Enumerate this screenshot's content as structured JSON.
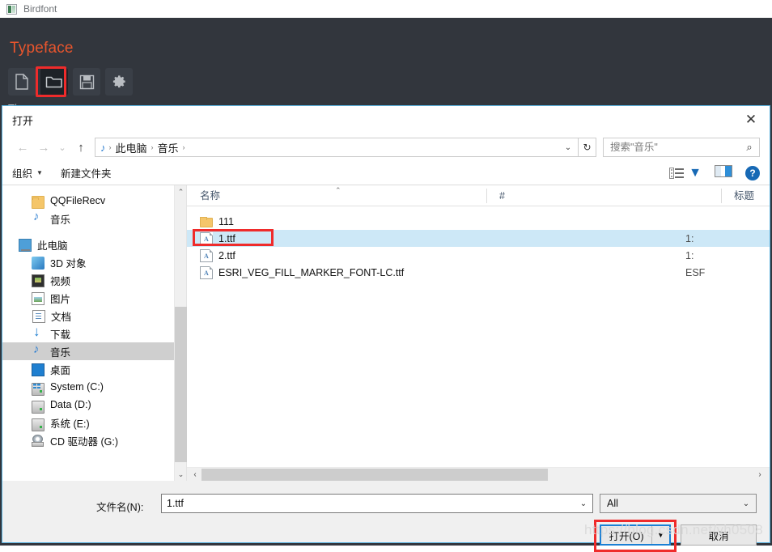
{
  "app": {
    "titlebar_title": "Birdfont",
    "section_title": "Typeface",
    "themes_label": "Themes",
    "accent_color": "#e8552d",
    "toolbar": [
      {
        "name": "new-file-icon",
        "label": "New"
      },
      {
        "name": "open-folder-icon",
        "label": "Open"
      },
      {
        "name": "save-icon",
        "label": "Save"
      },
      {
        "name": "settings-gear-icon",
        "label": "Settings"
      }
    ]
  },
  "dialog": {
    "title": "打开",
    "close_label": "✕",
    "nav": {
      "back": "←",
      "forward": "→",
      "recent": "⌄",
      "up": "↑"
    },
    "breadcrumb": {
      "leading_icon": "music-note-icon",
      "parts": [
        "此电脑",
        "音乐"
      ],
      "separator": "›",
      "caret": "⌄"
    },
    "refresh": "↻",
    "search": {
      "placeholder": "搜索\"音乐\"",
      "value": "",
      "icon": "search-icon"
    },
    "commands": {
      "organize": "组织",
      "organize_caret": "▼",
      "new_folder": "新建文件夹",
      "view_caret": "▼",
      "help": "?"
    },
    "tree": [
      {
        "label": "QQFileRecv",
        "icon": "folder-icon",
        "indent": 36,
        "selected": false
      },
      {
        "label": "音乐",
        "icon": "music-note-icon",
        "indent": 36,
        "selected": false
      },
      {
        "gap": true
      },
      {
        "label": "此电脑",
        "icon": "this-pc-icon",
        "indent": 20,
        "selected": false
      },
      {
        "label": "3D 对象",
        "icon": "3d-objects-icon",
        "indent": 36,
        "selected": false
      },
      {
        "label": "视频",
        "icon": "videos-icon",
        "indent": 36,
        "selected": false
      },
      {
        "label": "图片",
        "icon": "pictures-icon",
        "indent": 36,
        "selected": false
      },
      {
        "label": "文档",
        "icon": "documents-icon",
        "indent": 36,
        "selected": false
      },
      {
        "label": "下载",
        "icon": "downloads-icon",
        "indent": 36,
        "selected": false
      },
      {
        "label": "音乐",
        "icon": "music-note-icon",
        "indent": 36,
        "selected": true
      },
      {
        "label": "桌面",
        "icon": "desktop-icon",
        "indent": 36,
        "selected": false
      },
      {
        "label": "System (C:)",
        "icon": "system-drive-icon",
        "indent": 36,
        "selected": false
      },
      {
        "label": "Data (D:)",
        "icon": "drive-icon",
        "indent": 36,
        "selected": false
      },
      {
        "label": "系统 (E:)",
        "icon": "drive-icon",
        "indent": 36,
        "selected": false
      },
      {
        "label": "CD 驱动器 (G:)",
        "icon": "cd-drive-icon",
        "indent": 36,
        "selected": false
      }
    ],
    "columns": [
      {
        "label": "名称",
        "key": "name"
      },
      {
        "label": "#",
        "key": "hash"
      },
      {
        "label": "标题",
        "key": "title"
      }
    ],
    "sort_caret": "⌃",
    "files": [
      {
        "name": "111",
        "icon": "folder-icon",
        "hash": "",
        "title": "",
        "selected": false
      },
      {
        "name": "1.ttf",
        "icon": "font-file-icon",
        "hash": "1:",
        "title": "",
        "selected": true
      },
      {
        "name": "2.ttf",
        "icon": "font-file-icon",
        "hash": "1:",
        "title": "",
        "selected": false
      },
      {
        "name": "ESRI_VEG_FILL_MARKER_FONT-LC.ttf",
        "icon": "font-file-icon",
        "hash": "ESF",
        "title": "",
        "selected": false
      }
    ],
    "hscroll": {
      "left": "‹",
      "right": "›"
    },
    "vscroll": {
      "up": "⌃",
      "down": "⌄"
    },
    "footer": {
      "filename_label": "文件名(N):",
      "filename_value": "1.ttf",
      "filename_caret": "⌄",
      "filetype_value": "All",
      "filetype_caret": "⌄",
      "open_label": "打开(O)",
      "open_arrow": "▼",
      "cancel_label": "取消"
    }
  },
  "watermark": "https://blog.csdn.net/yh0508",
  "highlight_color": "#ef2b2b"
}
